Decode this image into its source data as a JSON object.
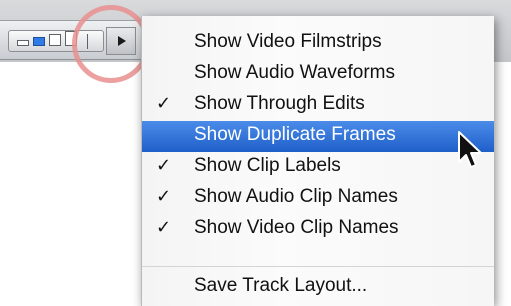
{
  "menu": {
    "items": [
      {
        "label": "Show Video Filmstrips",
        "check": ""
      },
      {
        "label": "Show Audio Waveforms",
        "check": ""
      },
      {
        "label": "Show Through Edits",
        "check": "✓"
      },
      {
        "label": "Show Duplicate Frames",
        "check": "",
        "selected": true
      },
      {
        "label": "Show Clip Labels",
        "check": "✓"
      },
      {
        "label": "Show Audio Clip Names",
        "check": "✓"
      },
      {
        "label": "Show Video Clip Names",
        "check": "✓"
      },
      {
        "label": "Save Track Layout...",
        "check": ""
      }
    ]
  },
  "colors": {
    "selection": "#2f6fd8",
    "highlight_circle": "#e98f8f"
  },
  "icons": {
    "layout_button": "triangle-right-icon",
    "pointer": "arrow-cursor-icon"
  }
}
